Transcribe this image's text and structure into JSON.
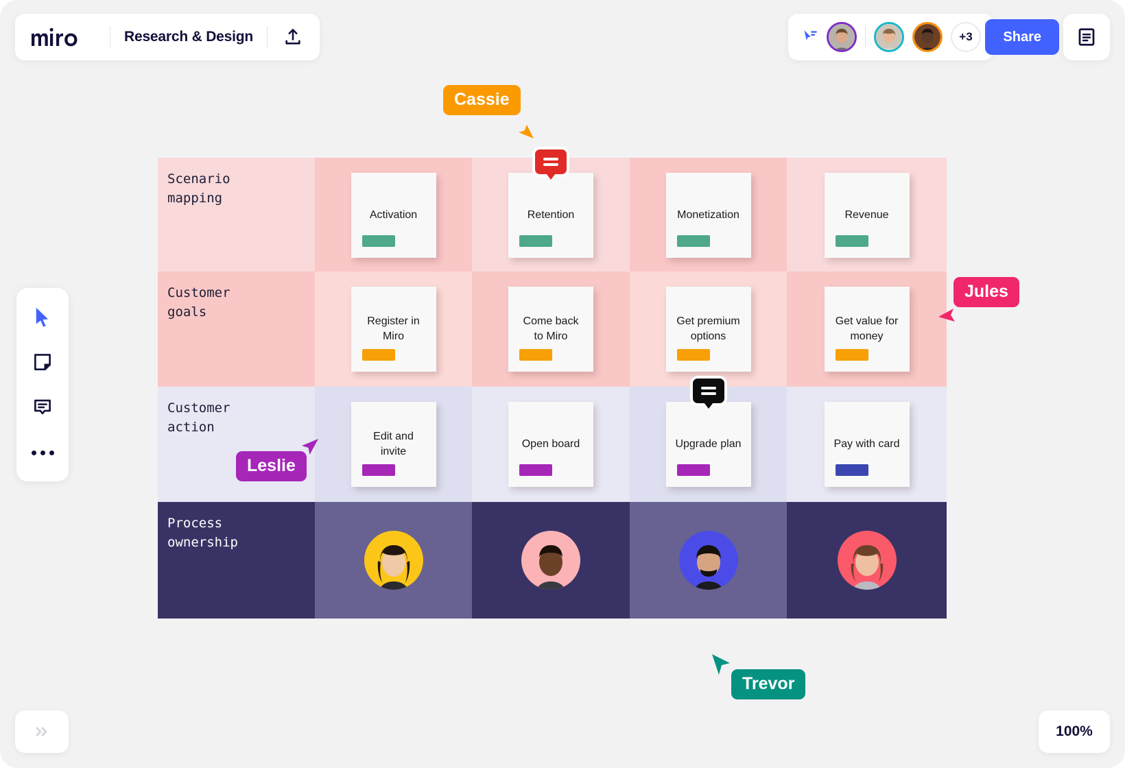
{
  "app": {
    "brand": "miro",
    "board_title": "Research & Design",
    "export_icon": "upload-icon",
    "notes_icon": "notes-panel-icon",
    "follow_icon": "follow-cursor-icon"
  },
  "collaborators": {
    "overflow_count": "+3",
    "avatars": [
      {
        "name": "collaborator-1",
        "ring": "#7b2ec4",
        "skin": "#d9a98a",
        "hair": "#6d4a33",
        "bg": "#b7b2aa",
        "shirt": "#6d6a74"
      },
      {
        "name": "collaborator-2",
        "ring": "#17b8c9",
        "skin": "#e8b898",
        "hair": "#8a6a4a",
        "bg": "#cfc6bb",
        "shirt": "#d9d2cc"
      },
      {
        "name": "collaborator-3",
        "ring": "#f79009",
        "skin": "#5a3a28",
        "hair": "#201410",
        "bg": "#6d3f25",
        "shirt": "#332119"
      }
    ]
  },
  "share": {
    "label": "Share",
    "color": "#4262ff"
  },
  "toolbar": {
    "items": [
      {
        "name": "select-tool",
        "icon": "cursor-icon",
        "active": true
      },
      {
        "name": "sticky-note-tool",
        "icon": "sticky-note-icon",
        "active": false
      },
      {
        "name": "comment-tool",
        "icon": "comment-icon",
        "active": false
      },
      {
        "name": "more-tools",
        "icon": "ellipsis-icon",
        "active": false
      }
    ]
  },
  "canvas_controls": {
    "expand_label": "»",
    "zoom_level": "100%"
  },
  "board": {
    "rows": [
      {
        "label": "Scenario\nmapping",
        "label_dark": false,
        "band": "r1",
        "tag_color": "#4da98a",
        "cards": [
          {
            "text": "Activation",
            "comment": null
          },
          {
            "text": "Retention",
            "comment": {
              "color": "#e02b27",
              "name": "comment-badge-red"
            }
          },
          {
            "text": "Monetization",
            "comment": null
          },
          {
            "text": "Revenue",
            "comment": null
          }
        ]
      },
      {
        "label": "Customer\ngoals",
        "label_dark": false,
        "band": "r2",
        "tag_color": "#f7a008",
        "cards": [
          {
            "text": "Register in\nMiro",
            "comment": null
          },
          {
            "text": "Come back\nto Miro",
            "comment": null
          },
          {
            "text": "Get premium\noptions",
            "comment": null
          },
          {
            "text": "Get value for\nmoney",
            "comment": null
          }
        ]
      },
      {
        "label": "Customer\naction",
        "label_dark": false,
        "band": "r3",
        "tag_color": "#a626b8",
        "cards": [
          {
            "text": "Edit and\ninvite",
            "comment": null
          },
          {
            "text": "Open board",
            "comment": null
          },
          {
            "text": "Upgrade plan",
            "comment": {
              "color": "#0d0d0d",
              "name": "comment-badge-black"
            }
          },
          {
            "text": "Pay with card",
            "comment": null,
            "tag_color": "#3b47b0"
          }
        ]
      },
      {
        "label": "Process\nownership",
        "label_dark": true,
        "band": "r4",
        "tag_color": null,
        "owners": [
          {
            "name": "owner-avatar-1",
            "bg": "#fcc618",
            "skin": "#f0c9a6",
            "hair": "#20150f",
            "shirt": "#2a2a30"
          },
          {
            "name": "owner-avatar-2",
            "bg": "#fbb3b6",
            "skin": "#6b4128",
            "hair": "#1a1008",
            "shirt": "#3a3a42"
          },
          {
            "name": "owner-avatar-3",
            "bg": "#4b4ce8",
            "skin": "#d7a482",
            "hair": "#15100c",
            "shirt": "#1a1a1f"
          },
          {
            "name": "owner-avatar-4",
            "bg": "#fb5a6a",
            "skin": "#eec0a2",
            "hair": "#6b4227",
            "shirt": "#b9bac2"
          }
        ]
      }
    ]
  },
  "cursors": [
    {
      "name": "Cassie",
      "color": "#fb9a00",
      "direction": "down-right"
    },
    {
      "name": "Jules",
      "color": "#f0276b",
      "direction": "left"
    },
    {
      "name": "Leslie",
      "color": "#a626b8",
      "direction": "up-right"
    },
    {
      "name": "Trevor",
      "color": "#059281",
      "direction": "up-left"
    }
  ]
}
